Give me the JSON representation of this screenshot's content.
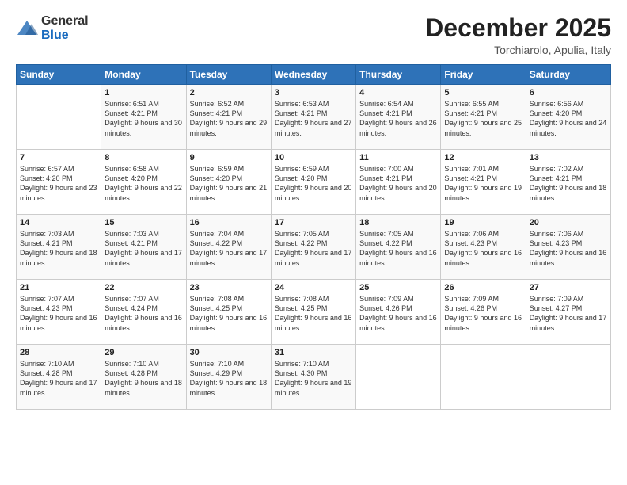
{
  "logo": {
    "general": "General",
    "blue": "Blue"
  },
  "header": {
    "month": "December 2025",
    "location": "Torchiarolo, Apulia, Italy"
  },
  "weekdays": [
    "Sunday",
    "Monday",
    "Tuesday",
    "Wednesday",
    "Thursday",
    "Friday",
    "Saturday"
  ],
  "weeks": [
    [
      {
        "day": "",
        "sunrise": "",
        "sunset": "",
        "daylight": ""
      },
      {
        "day": "1",
        "sunrise": "Sunrise: 6:51 AM",
        "sunset": "Sunset: 4:21 PM",
        "daylight": "Daylight: 9 hours and 30 minutes."
      },
      {
        "day": "2",
        "sunrise": "Sunrise: 6:52 AM",
        "sunset": "Sunset: 4:21 PM",
        "daylight": "Daylight: 9 hours and 29 minutes."
      },
      {
        "day": "3",
        "sunrise": "Sunrise: 6:53 AM",
        "sunset": "Sunset: 4:21 PM",
        "daylight": "Daylight: 9 hours and 27 minutes."
      },
      {
        "day": "4",
        "sunrise": "Sunrise: 6:54 AM",
        "sunset": "Sunset: 4:21 PM",
        "daylight": "Daylight: 9 hours and 26 minutes."
      },
      {
        "day": "5",
        "sunrise": "Sunrise: 6:55 AM",
        "sunset": "Sunset: 4:21 PM",
        "daylight": "Daylight: 9 hours and 25 minutes."
      },
      {
        "day": "6",
        "sunrise": "Sunrise: 6:56 AM",
        "sunset": "Sunset: 4:20 PM",
        "daylight": "Daylight: 9 hours and 24 minutes."
      }
    ],
    [
      {
        "day": "7",
        "sunrise": "Sunrise: 6:57 AM",
        "sunset": "Sunset: 4:20 PM",
        "daylight": "Daylight: 9 hours and 23 minutes."
      },
      {
        "day": "8",
        "sunrise": "Sunrise: 6:58 AM",
        "sunset": "Sunset: 4:20 PM",
        "daylight": "Daylight: 9 hours and 22 minutes."
      },
      {
        "day": "9",
        "sunrise": "Sunrise: 6:59 AM",
        "sunset": "Sunset: 4:20 PM",
        "daylight": "Daylight: 9 hours and 21 minutes."
      },
      {
        "day": "10",
        "sunrise": "Sunrise: 6:59 AM",
        "sunset": "Sunset: 4:20 PM",
        "daylight": "Daylight: 9 hours and 20 minutes."
      },
      {
        "day": "11",
        "sunrise": "Sunrise: 7:00 AM",
        "sunset": "Sunset: 4:21 PM",
        "daylight": "Daylight: 9 hours and 20 minutes."
      },
      {
        "day": "12",
        "sunrise": "Sunrise: 7:01 AM",
        "sunset": "Sunset: 4:21 PM",
        "daylight": "Daylight: 9 hours and 19 minutes."
      },
      {
        "day": "13",
        "sunrise": "Sunrise: 7:02 AM",
        "sunset": "Sunset: 4:21 PM",
        "daylight": "Daylight: 9 hours and 18 minutes."
      }
    ],
    [
      {
        "day": "14",
        "sunrise": "Sunrise: 7:03 AM",
        "sunset": "Sunset: 4:21 PM",
        "daylight": "Daylight: 9 hours and 18 minutes."
      },
      {
        "day": "15",
        "sunrise": "Sunrise: 7:03 AM",
        "sunset": "Sunset: 4:21 PM",
        "daylight": "Daylight: 9 hours and 17 minutes."
      },
      {
        "day": "16",
        "sunrise": "Sunrise: 7:04 AM",
        "sunset": "Sunset: 4:22 PM",
        "daylight": "Daylight: 9 hours and 17 minutes."
      },
      {
        "day": "17",
        "sunrise": "Sunrise: 7:05 AM",
        "sunset": "Sunset: 4:22 PM",
        "daylight": "Daylight: 9 hours and 17 minutes."
      },
      {
        "day": "18",
        "sunrise": "Sunrise: 7:05 AM",
        "sunset": "Sunset: 4:22 PM",
        "daylight": "Daylight: 9 hours and 16 minutes."
      },
      {
        "day": "19",
        "sunrise": "Sunrise: 7:06 AM",
        "sunset": "Sunset: 4:23 PM",
        "daylight": "Daylight: 9 hours and 16 minutes."
      },
      {
        "day": "20",
        "sunrise": "Sunrise: 7:06 AM",
        "sunset": "Sunset: 4:23 PM",
        "daylight": "Daylight: 9 hours and 16 minutes."
      }
    ],
    [
      {
        "day": "21",
        "sunrise": "Sunrise: 7:07 AM",
        "sunset": "Sunset: 4:23 PM",
        "daylight": "Daylight: 9 hours and 16 minutes."
      },
      {
        "day": "22",
        "sunrise": "Sunrise: 7:07 AM",
        "sunset": "Sunset: 4:24 PM",
        "daylight": "Daylight: 9 hours and 16 minutes."
      },
      {
        "day": "23",
        "sunrise": "Sunrise: 7:08 AM",
        "sunset": "Sunset: 4:25 PM",
        "daylight": "Daylight: 9 hours and 16 minutes."
      },
      {
        "day": "24",
        "sunrise": "Sunrise: 7:08 AM",
        "sunset": "Sunset: 4:25 PM",
        "daylight": "Daylight: 9 hours and 16 minutes."
      },
      {
        "day": "25",
        "sunrise": "Sunrise: 7:09 AM",
        "sunset": "Sunset: 4:26 PM",
        "daylight": "Daylight: 9 hours and 16 minutes."
      },
      {
        "day": "26",
        "sunrise": "Sunrise: 7:09 AM",
        "sunset": "Sunset: 4:26 PM",
        "daylight": "Daylight: 9 hours and 16 minutes."
      },
      {
        "day": "27",
        "sunrise": "Sunrise: 7:09 AM",
        "sunset": "Sunset: 4:27 PM",
        "daylight": "Daylight: 9 hours and 17 minutes."
      }
    ],
    [
      {
        "day": "28",
        "sunrise": "Sunrise: 7:10 AM",
        "sunset": "Sunset: 4:28 PM",
        "daylight": "Daylight: 9 hours and 17 minutes."
      },
      {
        "day": "29",
        "sunrise": "Sunrise: 7:10 AM",
        "sunset": "Sunset: 4:28 PM",
        "daylight": "Daylight: 9 hours and 18 minutes."
      },
      {
        "day": "30",
        "sunrise": "Sunrise: 7:10 AM",
        "sunset": "Sunset: 4:29 PM",
        "daylight": "Daylight: 9 hours and 18 minutes."
      },
      {
        "day": "31",
        "sunrise": "Sunrise: 7:10 AM",
        "sunset": "Sunset: 4:30 PM",
        "daylight": "Daylight: 9 hours and 19 minutes."
      },
      {
        "day": "",
        "sunrise": "",
        "sunset": "",
        "daylight": ""
      },
      {
        "day": "",
        "sunrise": "",
        "sunset": "",
        "daylight": ""
      },
      {
        "day": "",
        "sunrise": "",
        "sunset": "",
        "daylight": ""
      }
    ]
  ]
}
